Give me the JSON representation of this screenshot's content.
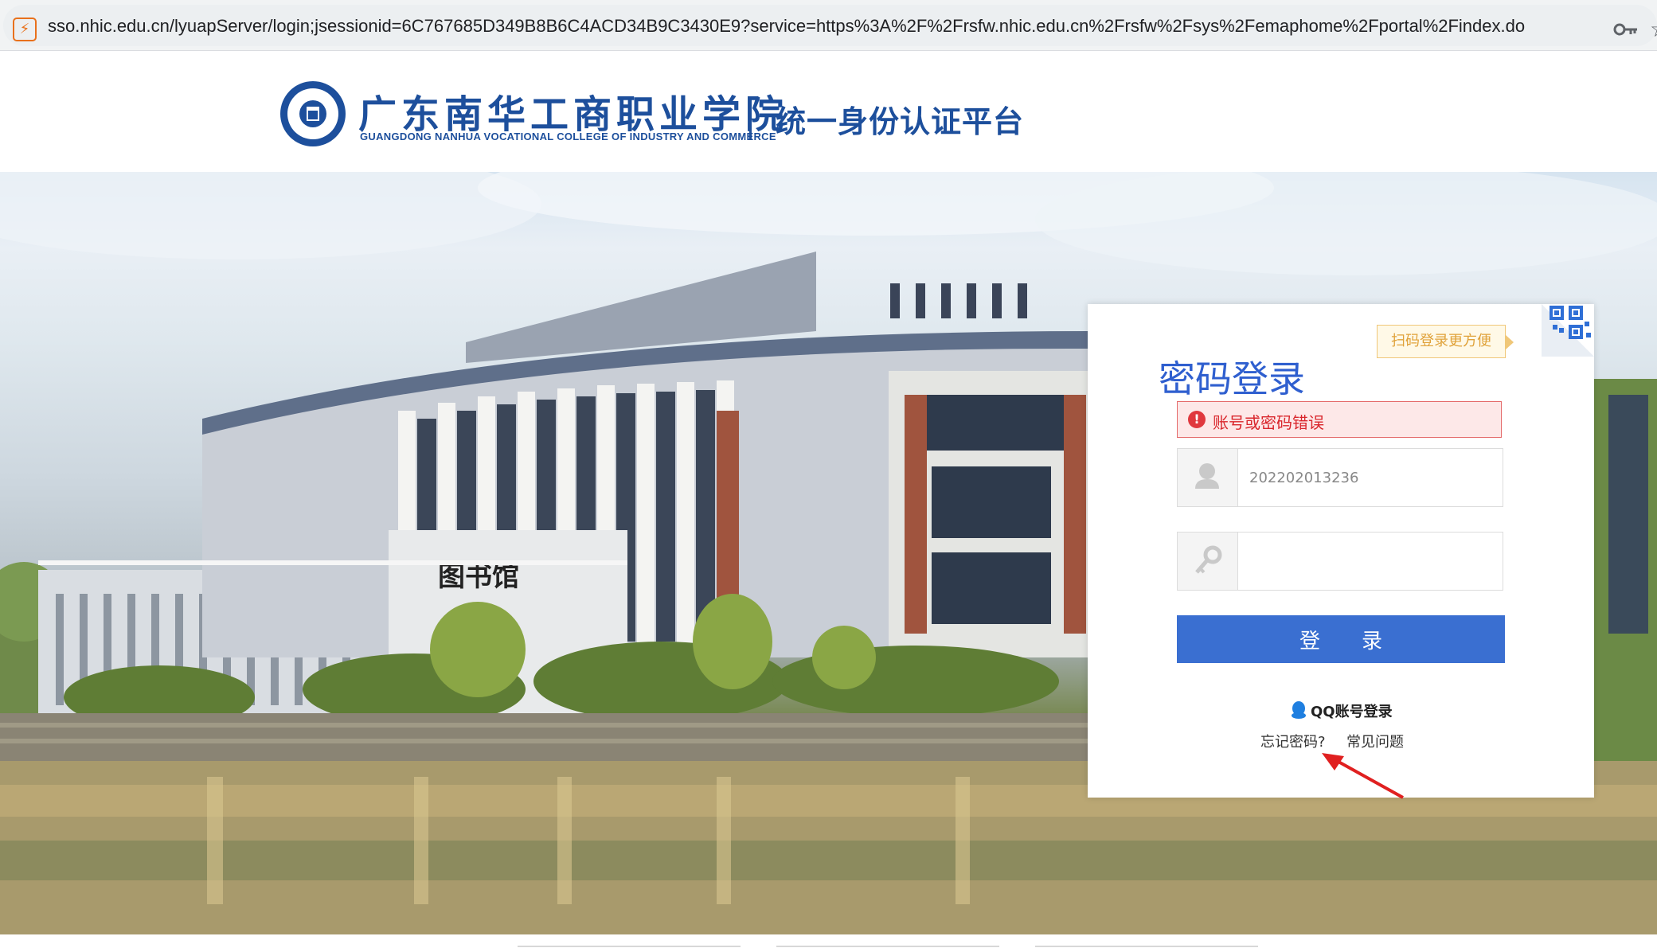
{
  "browser": {
    "url": "sso.nhic.edu.cn/lyuapServer/login;jsessionid=6C767685D349B8B6C4ACD34B9C3430E9?service=https%3A%2F%2Frsfw.nhic.edu.cn%2Frsfw%2Fsys%2Femaphome%2Fportal%2Findex.do",
    "site_icon": "page-icon",
    "right_icon": "key-icon"
  },
  "header": {
    "school_name_cn": "广东南华工商职业学院",
    "school_name_en": "GUANGDONG NANHUA VOCATIONAL COLLEGE OF INDUSTRY AND COMMERCE",
    "platform_title": "统一身份认证平台",
    "brand_color": "#1d4f9c"
  },
  "hero": {
    "building_sign": "图书馆"
  },
  "login": {
    "qr_tip": "扫码登录更方便",
    "title": "密码登录",
    "error_message": "账号或密码错误",
    "username_value": "202202013236",
    "password_value": "",
    "submit_label": "登　　录",
    "qq_login_label": "QQ账号登录",
    "forgot_password_label": "忘记密码?",
    "faq_label": "常见问题",
    "accent_color": "#3a6fd1",
    "error_color": "#d9262c"
  }
}
